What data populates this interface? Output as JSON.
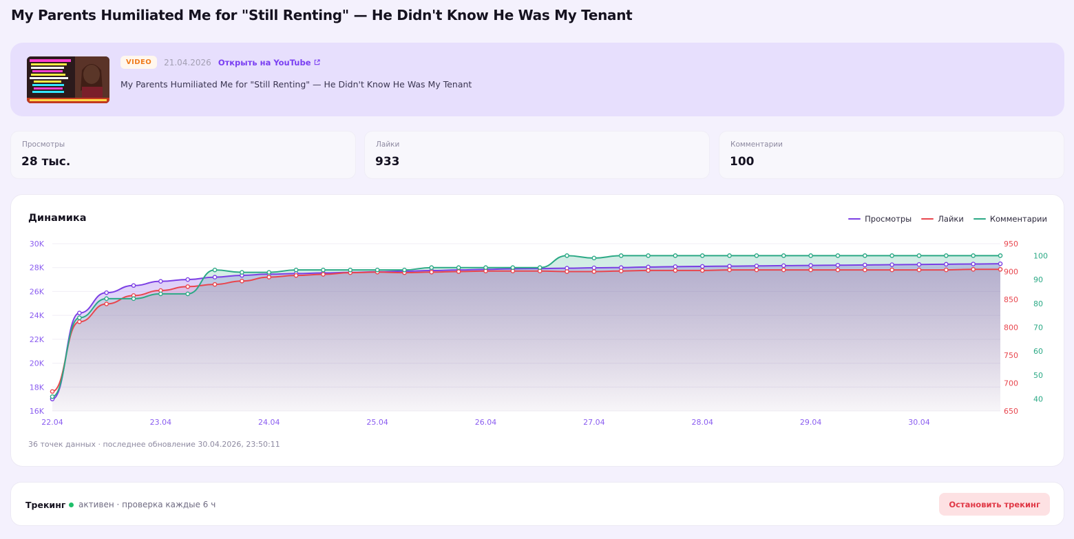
{
  "page": {
    "title": "My Parents Humiliated Me for \"Still Renting\" — He Didn't Know He Was My Tenant"
  },
  "video": {
    "badge": "VIDEO",
    "date": "21.04.2026",
    "youtube_link": "Открыть на YouTube",
    "description": "My Parents Humiliated Me for \"Still Renting\" — He Didn't Know He Was My Tenant",
    "thumbnail_icon": "video-thumbnail"
  },
  "stats": [
    {
      "label": "Просмотры",
      "value": "28 тыс."
    },
    {
      "label": "Лайки",
      "value": "933"
    },
    {
      "label": "Комментарии",
      "value": "100"
    }
  ],
  "chart": {
    "title": "Динамика",
    "legend": [
      "Просмотры",
      "Лайки",
      "Комментарии"
    ],
    "footer": "36 точек данных · последнее обновление 30.04.2026, 23:50:11"
  },
  "chart_data": {
    "type": "line",
    "x": [
      "22.04",
      "22.04",
      "22.04",
      "22.04",
      "23.04",
      "23.04",
      "23.04",
      "23.04",
      "24.04",
      "24.04",
      "24.04",
      "24.04",
      "25.04",
      "25.04",
      "25.04",
      "25.04",
      "26.04",
      "26.04",
      "26.04",
      "26.04",
      "27.04",
      "27.04",
      "27.04",
      "27.04",
      "28.04",
      "28.04",
      "28.04",
      "28.04",
      "29.04",
      "29.04",
      "29.04",
      "29.04",
      "30.04",
      "30.04",
      "30.04",
      "30.04"
    ],
    "x_ticks": [
      "22.04",
      "23.04",
      "24.04",
      "25.04",
      "26.04",
      "27.04",
      "28.04",
      "29.04",
      "30.04"
    ],
    "series": [
      {
        "name": "Просмотры",
        "color": "#7b3fe4",
        "axis": "left",
        "values": [
          17000,
          24200,
          25900,
          26500,
          26850,
          27000,
          27200,
          27350,
          27450,
          27500,
          27550,
          27600,
          27650,
          27700,
          27750,
          27800,
          27850,
          27900,
          27920,
          27950,
          27980,
          28000,
          28050,
          28080,
          28100,
          28120,
          28140,
          28160,
          28180,
          28200,
          28220,
          28240,
          28260,
          28280,
          28300,
          28320
        ]
      },
      {
        "name": "Лайки",
        "color": "#e8454d",
        "axis": "right",
        "values": [
          685,
          810,
          842,
          857,
          866,
          873,
          877,
          883,
          890,
          893,
          895,
          898,
          899,
          898,
          899,
          900,
          901,
          901,
          901,
          900,
          900,
          901,
          902,
          902,
          902,
          903,
          903,
          903,
          903,
          903,
          903,
          903,
          903,
          903,
          904,
          904
        ]
      },
      {
        "name": "Комментарии",
        "color": "#2ba985",
        "axis": "right2",
        "values": [
          41,
          74,
          82,
          82,
          84,
          84,
          94,
          93,
          93,
          94,
          94,
          94,
          94,
          94,
          95,
          95,
          95,
          95,
          95,
          100,
          99,
          100,
          100,
          100,
          100,
          100,
          100,
          100,
          100,
          100,
          100,
          100,
          100,
          100,
          100,
          100
        ]
      }
    ],
    "y_left": {
      "ticks": [
        "16K",
        "18K",
        "20K",
        "22K",
        "24K",
        "24K",
        "26K",
        "28K",
        "30K"
      ],
      "range": [
        16000,
        30000
      ]
    },
    "y_right": {
      "ticks": [
        "650",
        "700",
        "750",
        "800",
        "850",
        "900",
        "950"
      ],
      "range": [
        650,
        950
      ]
    },
    "y_right2": {
      "ticks": [
        "40",
        "50",
        "60",
        "70",
        "80",
        "90",
        "100"
      ],
      "range": [
        35,
        105
      ]
    },
    "grid": true,
    "legend_position": "top-right"
  },
  "tracking": {
    "label": "Трекинг",
    "status": "активен · проверка каждые 6 ч",
    "status_color": "#1fbf6a",
    "stop_button": "Остановить трекинг"
  }
}
